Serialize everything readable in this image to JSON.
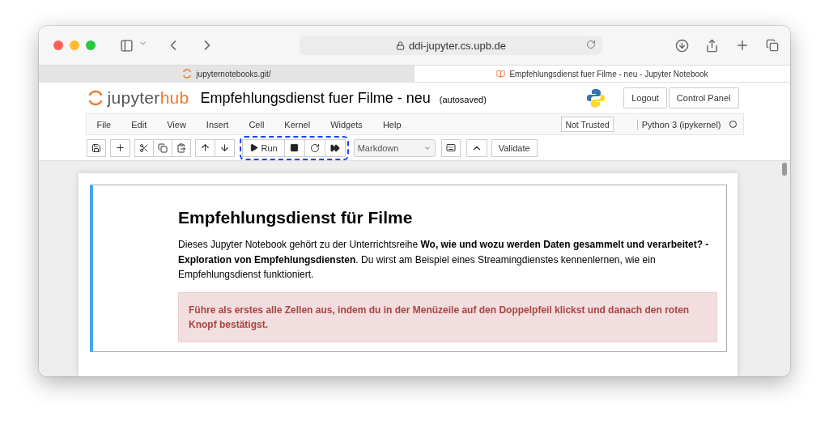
{
  "browser": {
    "address": "ddi-jupyter.cs.upb.de",
    "tabs": [
      {
        "title": "jupyternotebooks.git/",
        "kind": "jupyter",
        "selected": false
      },
      {
        "title": "Empfehlungsdienst fuer Filme - neu - Jupyter Notebook",
        "kind": "book",
        "selected": true
      }
    ]
  },
  "header": {
    "logo": {
      "prefix": "jupyter",
      "suffix": "hub"
    },
    "notebook_title": "Empfehlungsdienst fuer Filme - neu",
    "save_status": "(autosaved)",
    "buttons": [
      "Logout",
      "Control Panel"
    ]
  },
  "menu": {
    "items": [
      "File",
      "Edit",
      "View",
      "Insert",
      "Cell",
      "Kernel",
      "Widgets",
      "Help"
    ],
    "trust": "Not Trusted",
    "kernel": "Python 3 (ipykernel)"
  },
  "toolbar": {
    "run_label": "Run",
    "run_group_highlighted": true,
    "cell_type": "Markdown",
    "validate_label": "Validate"
  },
  "cell": {
    "selected": true,
    "heading": "Empfehlungsdienst für Filme",
    "paragraph": "Dieses Jupyter Notebook gehört zu der Unterrichtsreihe **Wo, wie und wozu werden Daten gesammelt und verarbeitet? - Exploration von Empfehlungsdiensten**. Du wirst am Beispiel eines Streamingdienstes kennenlernen, wie ein Empfehlungsdienst funktioniert.",
    "alert": "Führe als erstes alle Zellen aus, indem du in der Menüzeile auf den Doppelpfeil klickst und danach den roten Knopf bestätigst."
  }
}
